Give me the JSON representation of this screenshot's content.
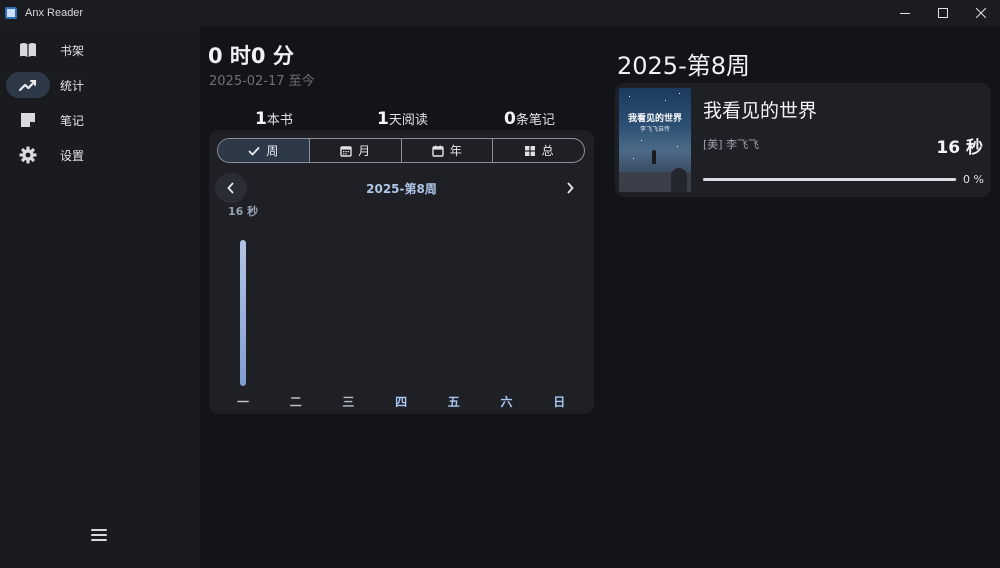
{
  "window": {
    "title": "Anx Reader"
  },
  "sidebar": {
    "items": [
      {
        "label": "书架",
        "icon": "book-open-icon"
      },
      {
        "label": "统计",
        "icon": "trend-chart-icon",
        "active": true
      },
      {
        "label": "笔记",
        "icon": "note-icon"
      },
      {
        "label": "设置",
        "icon": "gear-icon"
      }
    ]
  },
  "main": {
    "total_time": "0 时0 分",
    "since": "2025-02-17 至今",
    "stats": [
      {
        "value": "1",
        "label": "本书"
      },
      {
        "value": "1",
        "label": "天阅读"
      },
      {
        "value": "0",
        "label": "条笔记"
      }
    ],
    "tabs": [
      "周",
      "月",
      "年",
      "总"
    ],
    "active_tab": "周",
    "week_label": "2025-第8周",
    "max_label": "16 秒"
  },
  "chart_data": {
    "type": "bar",
    "categories": [
      "一",
      "二",
      "三",
      "四",
      "五",
      "六",
      "日"
    ],
    "values": [
      16,
      0,
      0,
      0,
      0,
      0,
      0
    ],
    "ylabel": "",
    "ylim": [
      0,
      16
    ]
  },
  "right": {
    "week_title": "2025-第8周",
    "book": {
      "title": "我看见的世界",
      "author": "[美] 李飞飞",
      "time": "16 秒",
      "progress": 0,
      "progress_text": "0 %",
      "cover_title": "我看见的世界",
      "cover_subtitle": "李飞飞自传"
    }
  },
  "colors": {
    "accent": "#2d3947",
    "bar_top": "#b4c6e6",
    "bar_bottom": "#7f9dd1",
    "day_label_dim": "#b8bdc6",
    "day_label_future": "#a9c6f0"
  }
}
